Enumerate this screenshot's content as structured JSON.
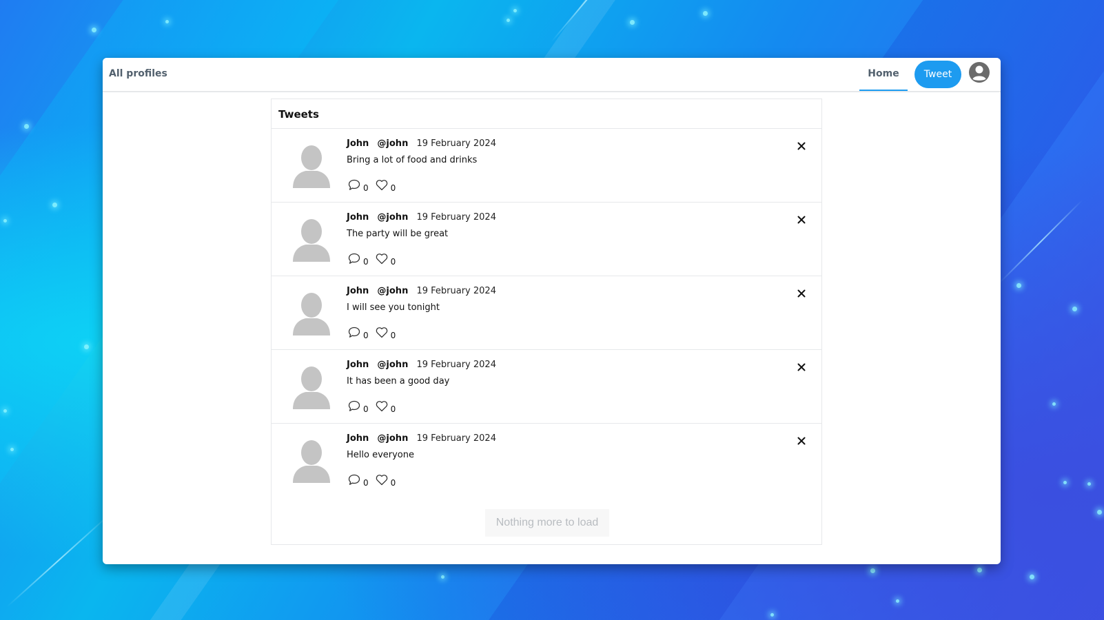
{
  "topbar": {
    "brand": "All profiles",
    "home_label": "Home",
    "tweet_button": "Tweet",
    "accent_color": "#1d9bf0"
  },
  "feed": {
    "title": "Tweets",
    "tweets": [
      {
        "name": "John",
        "handle": "@john",
        "date": "19 February 2024",
        "text": "Bring a lot of food and drinks",
        "replies": "0",
        "likes": "0"
      },
      {
        "name": "John",
        "handle": "@john",
        "date": "19 February 2024",
        "text": "The party will be great",
        "replies": "0",
        "likes": "0"
      },
      {
        "name": "John",
        "handle": "@john",
        "date": "19 February 2024",
        "text": "I will see you tonight",
        "replies": "0",
        "likes": "0"
      },
      {
        "name": "John",
        "handle": "@john",
        "date": "19 February 2024",
        "text": "It has been a good day",
        "replies": "0",
        "likes": "0"
      },
      {
        "name": "John",
        "handle": "@john",
        "date": "19 February 2024",
        "text": "Hello everyone",
        "replies": "0",
        "likes": "0"
      }
    ],
    "load_more_label": "Nothing more to load"
  },
  "icons": {
    "account": "account-circle-icon",
    "avatar": "default-avatar-icon",
    "reply": "comment-icon",
    "like": "heart-icon",
    "delete": "close-icon"
  }
}
